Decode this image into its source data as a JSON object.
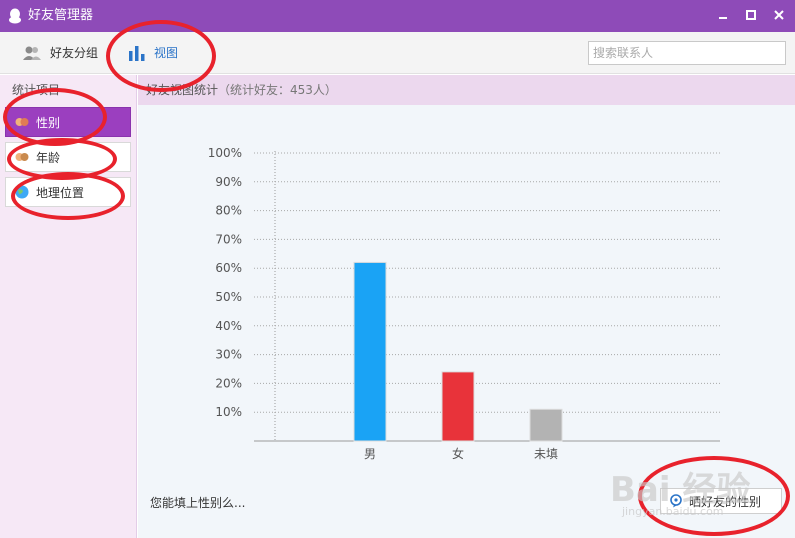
{
  "window": {
    "title": "好友管理器"
  },
  "toolbar": {
    "group_label": "好友分组",
    "view_label": "视图"
  },
  "search": {
    "placeholder": "搜索联系人"
  },
  "sidebar": {
    "heading": "统计项目",
    "items": [
      {
        "label": "性别",
        "selected": true
      },
      {
        "label": "年龄",
        "selected": false
      },
      {
        "label": "地理位置",
        "selected": false
      }
    ]
  },
  "main": {
    "header_title": "好友视图统计",
    "header_sub": "（统计好友：453人）",
    "footer_text": "您能填上性别么...",
    "share_label": "晒好友的性别"
  },
  "chart_data": {
    "type": "bar",
    "categories": [
      "男",
      "女",
      "未填"
    ],
    "values": [
      62,
      24,
      11
    ],
    "yticks": [
      "10%",
      "20%",
      "30%",
      "40%",
      "50%",
      "60%",
      "70%",
      "80%",
      "90%",
      "100%"
    ],
    "ylim": [
      0,
      100
    ],
    "colors": [
      "#1aa3f5",
      "#e8333a",
      "#b3b3b3"
    ],
    "grid": true
  },
  "watermark": {
    "text": "Bai 经验",
    "sub": "jingyan.baidu.com"
  },
  "colors": {
    "titlebar": "#8e4bb8",
    "selected_item": "#9b3fbf",
    "accent_blue": "#2b74c8",
    "annotation": "#e8222c"
  }
}
